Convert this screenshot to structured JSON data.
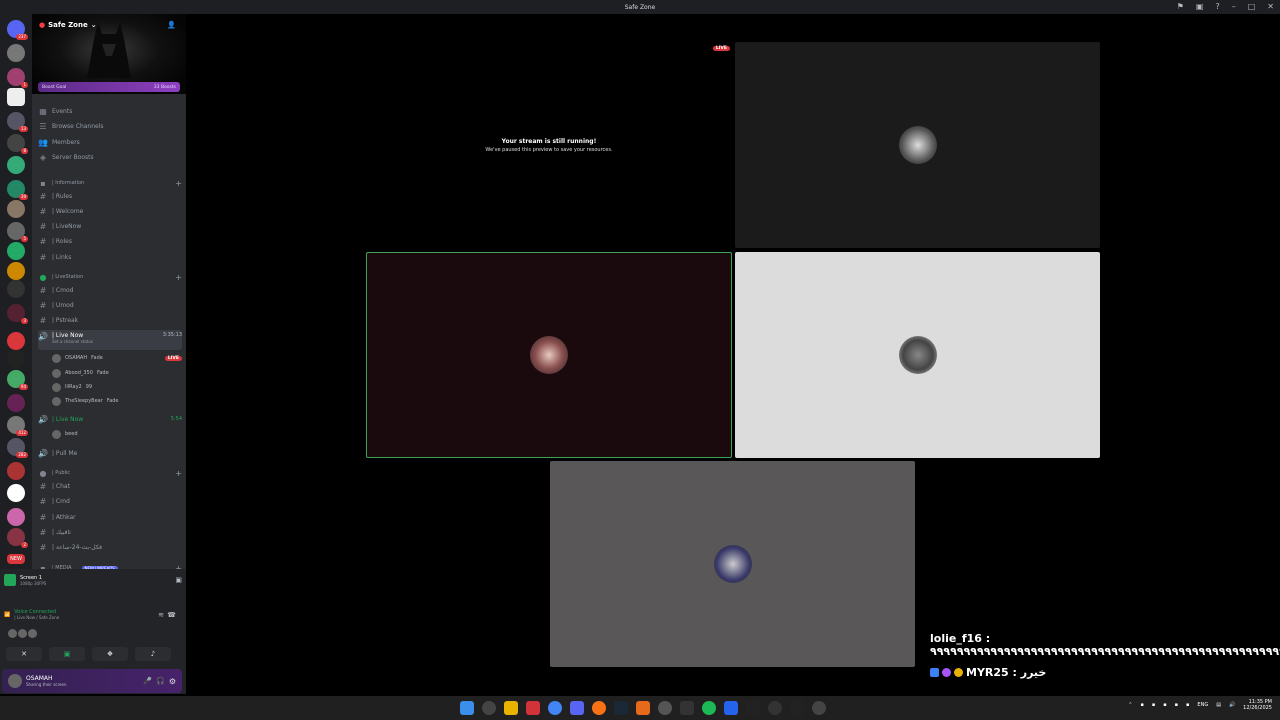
{
  "window": {
    "title": "Safe Zone"
  },
  "server": {
    "name": "Safe Zone",
    "boost_goal": "Boost Goal",
    "boosts": "33 Boosts"
  },
  "guild_badges": [
    "237",
    "1",
    "1",
    "13",
    "8",
    "39",
    "5",
    "3",
    "412",
    "1",
    "94",
    "282",
    "2",
    "NEW"
  ],
  "nav": {
    "events": "Events",
    "browse_channels": "Browse Channels",
    "members": "Members",
    "server_boosts": "Server Boosts"
  },
  "categories": {
    "information": "| Information",
    "livestation": "| LiveStation",
    "public": "| Public",
    "media": "| MEDIA"
  },
  "info_channels": [
    "| Rules",
    "| Welcome",
    "| LiveNow",
    "| Roles",
    "| Links"
  ],
  "live_channels": [
    "| Cmod",
    "| Umod",
    "| Pstreak"
  ],
  "voice1": {
    "name": "| Live Now",
    "timer": "3:35:13",
    "status": "Set a channel status"
  },
  "voice1_users": [
    {
      "name": "OSAMAH",
      "tag": "Fade",
      "live": "LIVE"
    },
    {
      "name": "Abood_350",
      "tag": "Fade",
      "live": ""
    },
    {
      "name": "lilRay2",
      "tag": "99",
      "live": ""
    },
    {
      "name": "TheSleepyBear",
      "tag": "Fade",
      "live": ""
    }
  ],
  "voice2": {
    "name": "| Live Now",
    "timer": "5:54"
  },
  "voice2_users": [
    {
      "name": "beed"
    }
  ],
  "voice3": {
    "name": "| Pull Me"
  },
  "public_channels": [
    "| Chat",
    "| Cmd",
    "| Athkar",
    "| ثاقبيك",
    "| فكل-بث-24-ساعة"
  ],
  "new_unreads": "NEW UNREADS",
  "screen": {
    "title": "Screen 1",
    "sub": "1080p 30FPS"
  },
  "voice": {
    "status": "Voice Connected",
    "channel": "| Live Now / Safe Zone"
  },
  "user": {
    "name": "OSAMAH",
    "status": "Sharing their screen"
  },
  "stream": {
    "title": "Your stream is still running!",
    "sub": "We've paused this preview to save your resources.",
    "live": "LIVE"
  },
  "chat_overlay": [
    {
      "text": "lolie_f16 : ٩٩٩٩٩٩٩٩٩٩٩٩٩٩٩٩٩٩٩٩٩٩٩٩٩٩٩٩٩٩٩٩٩٩٩٩٩٩٩٩٩٩٩٩٩٩٩٩٩٩٩٩٩٩٩"
    },
    {
      "text": "MYR25 : خيرر"
    }
  ],
  "taskbar": {
    "lang": "ENG",
    "time": "11:35 PM",
    "date": "12/26/2025"
  }
}
